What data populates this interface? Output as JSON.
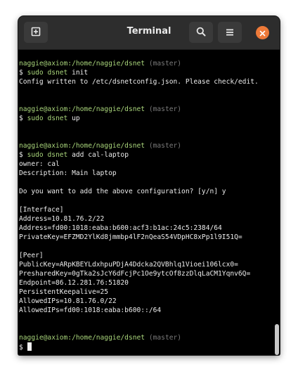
{
  "window": {
    "title": "Terminal"
  },
  "header": {
    "new_tab_icon": "new-tab-icon",
    "search_icon": "search-icon",
    "menu_icon": "hamburger-menu-icon",
    "close_icon": "close-icon",
    "close_color": "#ee7a39"
  },
  "terminal": {
    "lines": [
      {
        "kind": "blank"
      },
      {
        "kind": "prompt",
        "user": "naggie@axiom:/home/naggie/dsnet",
        "branch": "(master)"
      },
      {
        "kind": "command",
        "sigil": "$ ",
        "cmd": "sudo dsnet",
        "args": " init"
      },
      {
        "kind": "text",
        "text": "Config written to /etc/dsnetconfig.json. Please check/edit."
      },
      {
        "kind": "blank"
      },
      {
        "kind": "blank"
      },
      {
        "kind": "prompt",
        "user": "naggie@axiom:/home/naggie/dsnet",
        "branch": "(master)"
      },
      {
        "kind": "command",
        "sigil": "$ ",
        "cmd": "sudo dsnet",
        "args": " up"
      },
      {
        "kind": "blank"
      },
      {
        "kind": "blank"
      },
      {
        "kind": "prompt",
        "user": "naggie@axiom:/home/naggie/dsnet",
        "branch": "(master)"
      },
      {
        "kind": "command",
        "sigil": "$ ",
        "cmd": "sudo dsnet",
        "args": " add cal-laptop"
      },
      {
        "kind": "text",
        "text": "owner: cal"
      },
      {
        "kind": "text",
        "text": "Description: Main laptop"
      },
      {
        "kind": "blank"
      },
      {
        "kind": "text",
        "text": "Do you want to add the above configuration? [y/n] y"
      },
      {
        "kind": "blank"
      },
      {
        "kind": "text",
        "text": "[Interface]"
      },
      {
        "kind": "text",
        "text": "Address=10.81.76.2/22"
      },
      {
        "kind": "text",
        "text": "Address=fd00:1018:eaba:b600:acf3:b1ac:24c5:2384/64"
      },
      {
        "kind": "text",
        "text": "PrivateKey=EFZMD2YlKd8jmmbp4lF2nQeaS54VDpHC8xPp1l9I51Q="
      },
      {
        "kind": "blank"
      },
      {
        "kind": "text",
        "text": "[Peer]"
      },
      {
        "kind": "text",
        "text": "PublicKey=ARpKBEYLdxhpuPDjA4Ddcka2QVBhlq1Vioei106lcx0="
      },
      {
        "kind": "text",
        "text": "PresharedKey=0gTka2sJcY6dFcjPc1Oe9ytcOf8zzDlqLaCM1Yqnv6Q="
      },
      {
        "kind": "text",
        "text": "Endpoint=86.12.281.76:51820"
      },
      {
        "kind": "text",
        "text": "PersistentKeepalive=25"
      },
      {
        "kind": "text",
        "text": "AllowedIPs=10.81.76.0/22"
      },
      {
        "kind": "text",
        "text": "AllowedIPs=fd00:1018:eaba:b600::/64"
      },
      {
        "kind": "blank"
      },
      {
        "kind": "blank"
      },
      {
        "kind": "prompt",
        "user": "naggie@axiom:/home/naggie/dsnet",
        "branch": "(master)"
      },
      {
        "kind": "cursorline",
        "sigil": "$ "
      }
    ]
  }
}
